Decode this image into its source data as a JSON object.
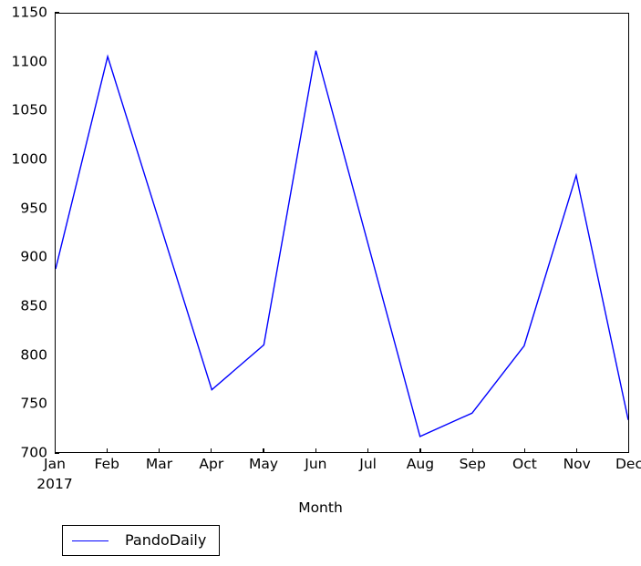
{
  "chart_data": {
    "type": "line",
    "title": "",
    "xlabel": "Month",
    "ylabel": "",
    "x_sublabel": "2017",
    "categories": [
      "Jan",
      "Feb",
      "Mar",
      "Apr",
      "May",
      "Jun",
      "Jul",
      "Aug",
      "Sep",
      "Oct",
      "Nov",
      "Dec"
    ],
    "xtick_labels": [
      "Jan",
      "Feb",
      "Mar",
      "Apr",
      "May",
      "Jun",
      "Jul",
      "Aug",
      "Sep",
      "Oct",
      "Nov",
      "Dec"
    ],
    "ytick_labels": [
      "700",
      "750",
      "800",
      "850",
      "900",
      "950",
      "1000",
      "1050",
      "1100",
      "1150"
    ],
    "yticks": [
      700,
      750,
      800,
      850,
      900,
      950,
      1000,
      1050,
      1100,
      1150
    ],
    "ylim": [
      700,
      1150
    ],
    "grid": false,
    "legend_position": "below-axes-left",
    "series": [
      {
        "name": "PandoDaily",
        "color": "#0000ff",
        "values": [
          888,
          1106,
          935,
          764,
          810,
          1112,
          914,
          716,
          740,
          809,
          984,
          733
        ]
      }
    ]
  },
  "legend": {
    "entries": [
      {
        "label": "PandoDaily",
        "color": "#0000ff"
      }
    ]
  },
  "axes": {
    "x_title": "Month",
    "x_year": "2017"
  }
}
